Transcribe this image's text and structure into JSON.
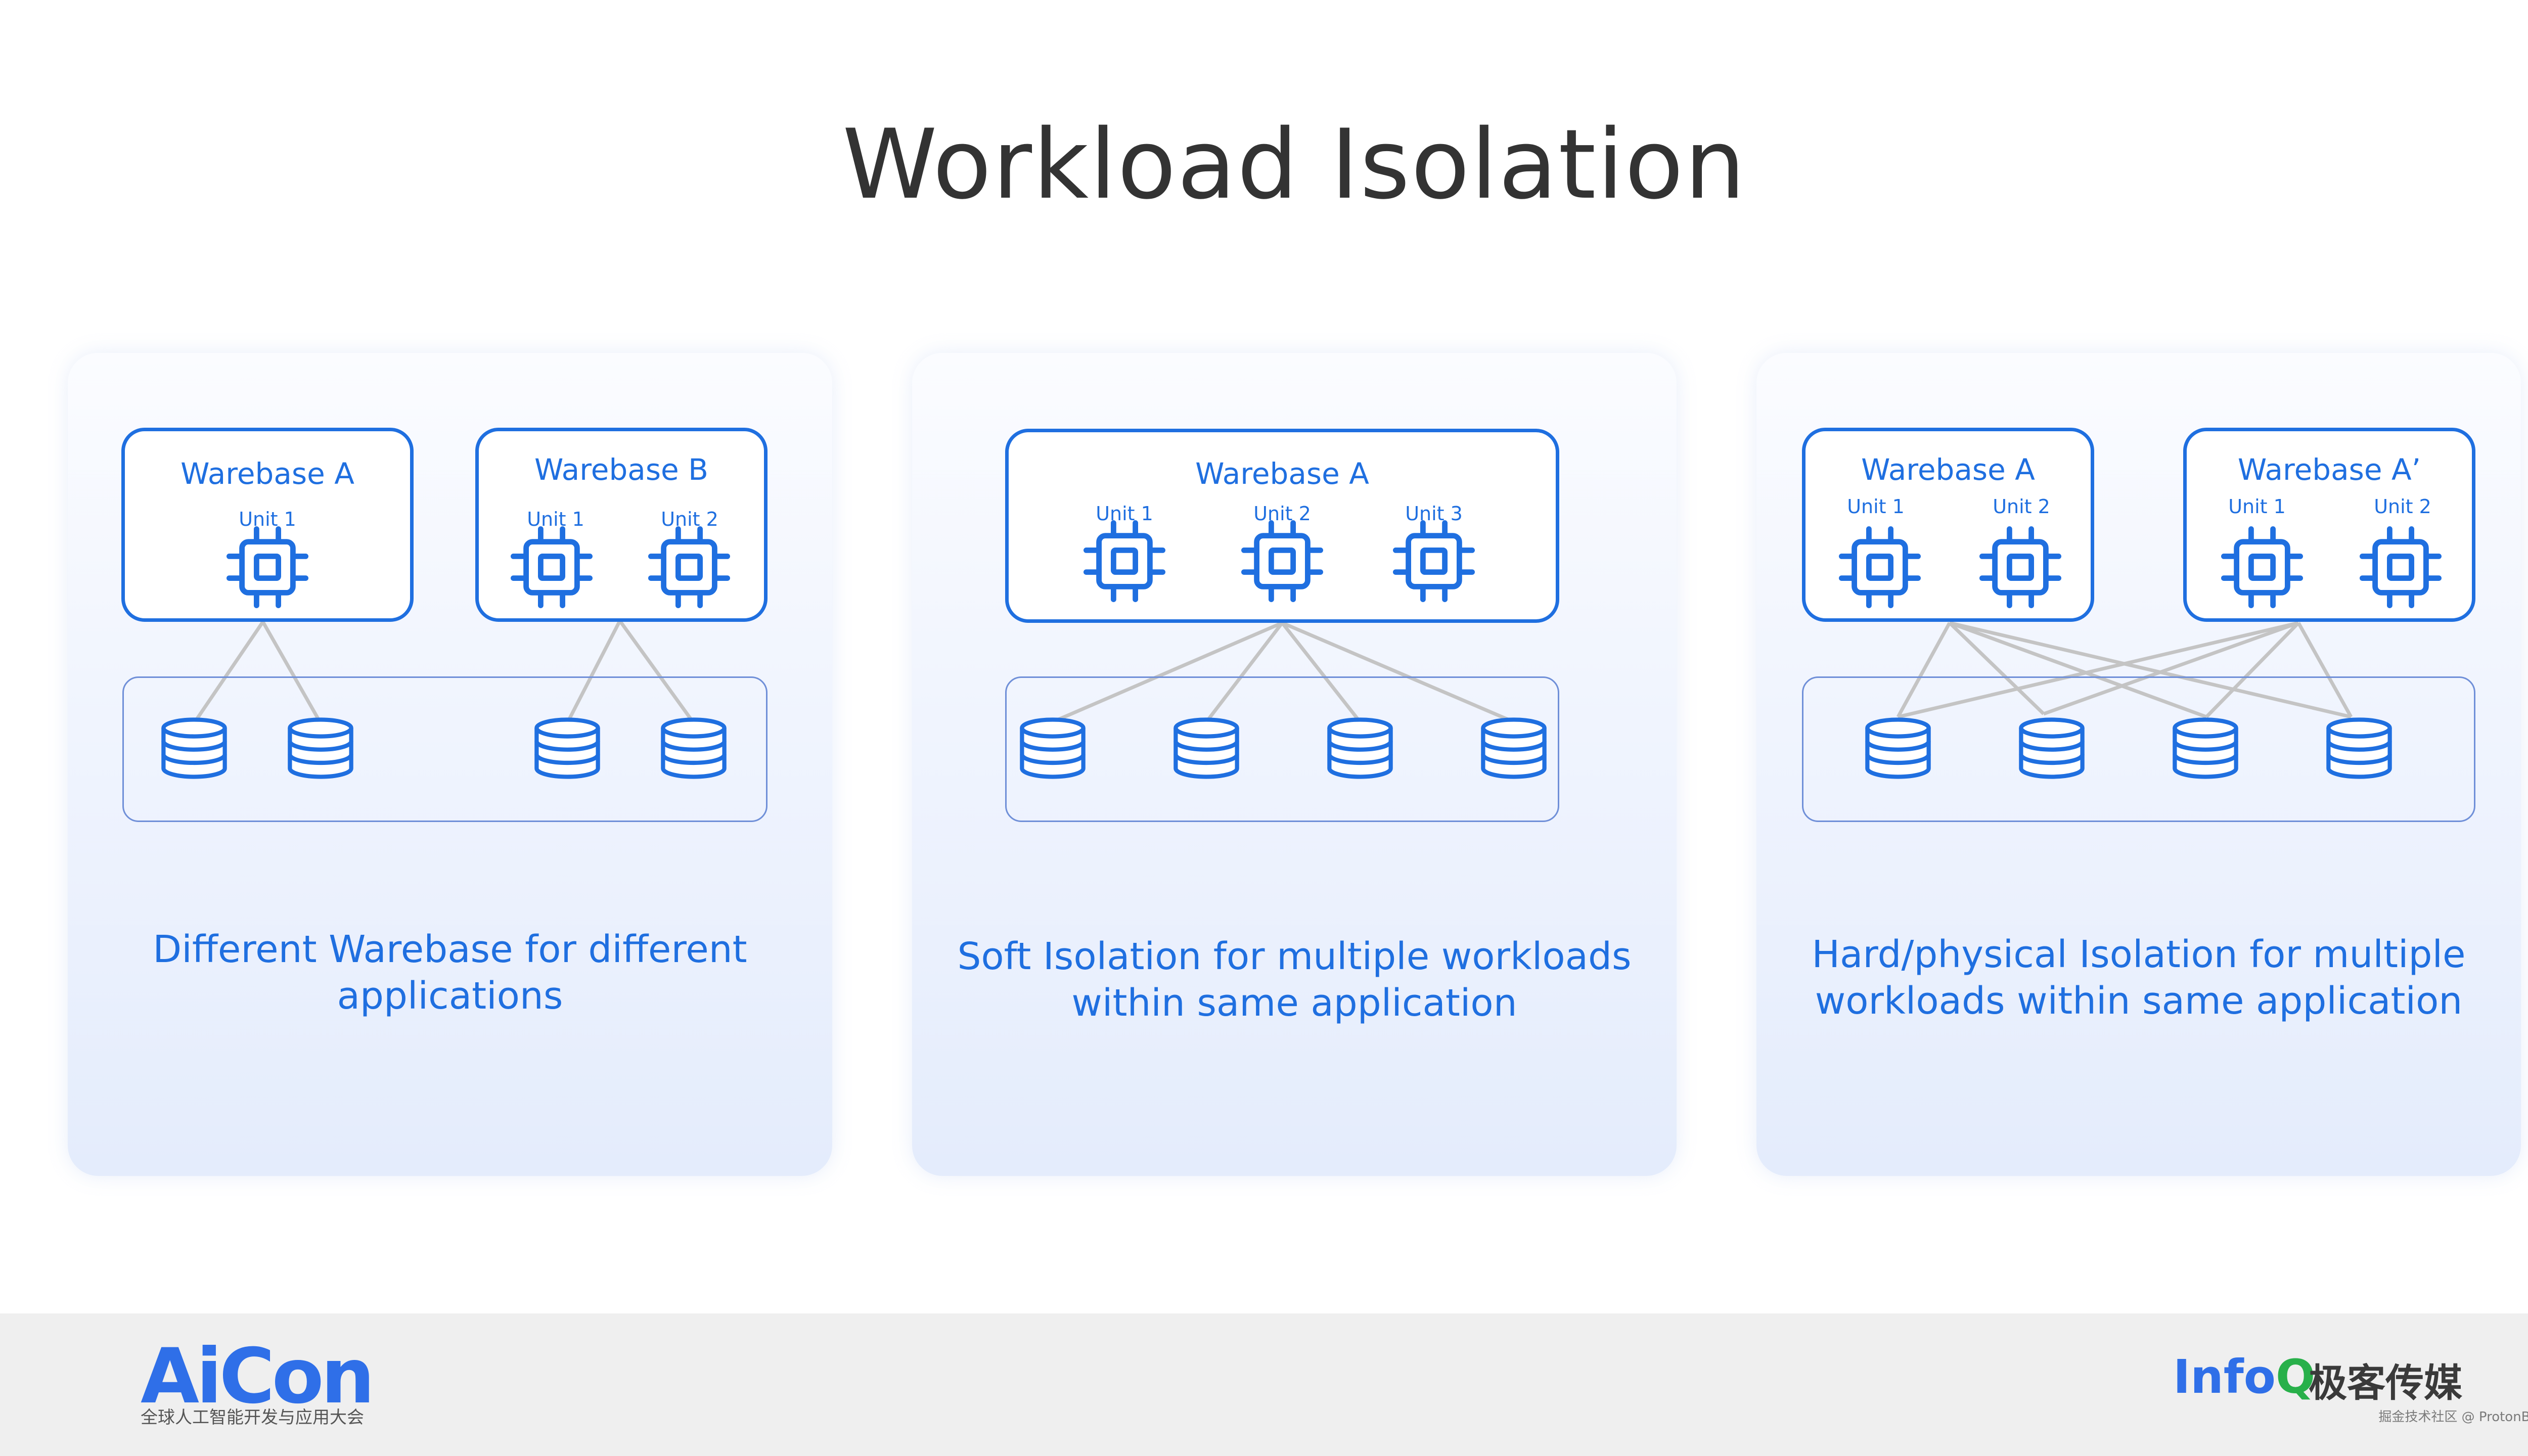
{
  "title": "Workload Isolation",
  "colors": {
    "accent": "#1f6fe0",
    "line": "#c4c4c4",
    "footer_bg": "#efefef",
    "panel_top": "#fbfcff",
    "panel_bottom": "#e4ecfc"
  },
  "icons": {
    "compute_unit": "cpu-chip-icon",
    "storage": "database-icon"
  },
  "panels": [
    {
      "warebases": [
        {
          "name": "Warebase A",
          "units": [
            "Unit 1"
          ]
        },
        {
          "name": "Warebase B",
          "units": [
            "Unit 1",
            "Unit 2"
          ]
        }
      ],
      "caption_line1": "Different Warebase for different",
      "caption_line2": "applications"
    },
    {
      "warebases": [
        {
          "name": "Warebase A",
          "units": [
            "Unit 1",
            "Unit 2",
            "Unit 3"
          ]
        }
      ],
      "caption_line1": "Soft Isolation for multiple workloads",
      "caption_line2": "within same application"
    },
    {
      "warebases": [
        {
          "name": "Warebase A",
          "units": [
            "Unit 1",
            "Unit 2"
          ]
        },
        {
          "name": "Warebase A’",
          "units": [
            "Unit 1",
            "Unit 2"
          ]
        }
      ],
      "caption_line1": "Hard/physical Isolation for multiple",
      "caption_line2": "workloads within same application"
    }
  ],
  "footer": {
    "aicon_logo": "AiCon",
    "aicon_tagline": "全球人工智能开发与应用大会",
    "infoq_logo_main": "Info",
    "infoq_logo_q": "Q",
    "infoq_cn": "极客传媒",
    "watermark": "掘金技术社区 @ ProtonBase"
  }
}
